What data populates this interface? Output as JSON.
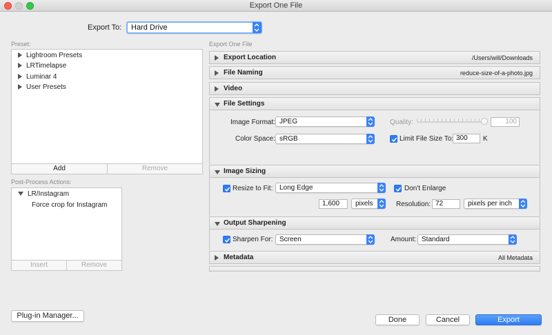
{
  "window": {
    "title": "Export One File"
  },
  "export_to": {
    "label": "Export To:",
    "value": "Hard Drive"
  },
  "left": {
    "preset_label": "Preset:",
    "presets": [
      "Lightroom Presets",
      "LRTimelapse",
      "Luminar 4",
      "User Presets"
    ],
    "add_label": "Add",
    "remove_label": "Remove",
    "post_label": "Post-Process Actions:",
    "post_group": "LR/Instagram",
    "post_item": "Force crop for Instagram",
    "insert_label": "Insert",
    "post_remove_label": "Remove"
  },
  "right": {
    "header_label": "Export One File",
    "sections": {
      "export_location": {
        "title": "Export Location",
        "summary": "/Users/will/Downloads"
      },
      "file_naming": {
        "title": "File Naming",
        "summary": "reduce-size-of-a-photo.jpg"
      },
      "video": {
        "title": "Video"
      },
      "file_settings": {
        "title": "File Settings",
        "image_format_label": "Image Format:",
        "image_format": "JPEG",
        "quality_label": "Quality:",
        "quality_value": "100",
        "color_space_label": "Color Space:",
        "color_space": "sRGB",
        "limit_label": "Limit File Size To:",
        "limit_value": "300",
        "limit_unit": "K"
      },
      "image_sizing": {
        "title": "Image Sizing",
        "resize_label": "Resize to Fit:",
        "resize_mode": "Long Edge",
        "dont_enlarge_label": "Don't Enlarge",
        "size_value": "1,600",
        "size_unit": "pixels",
        "resolution_label": "Resolution:",
        "resolution_value": "72",
        "resolution_unit": "pixels per inch"
      },
      "output_sharpening": {
        "title": "Output Sharpening",
        "sharpen_label": "Sharpen For:",
        "sharpen_for": "Screen",
        "amount_label": "Amount:",
        "amount": "Standard"
      },
      "metadata": {
        "title": "Metadata",
        "summary": "All Metadata"
      }
    }
  },
  "footer": {
    "plugin_manager": "Plug-in Manager...",
    "done": "Done",
    "cancel": "Cancel",
    "export": "Export"
  },
  "colors": {
    "accent": "#2f7cf6"
  }
}
